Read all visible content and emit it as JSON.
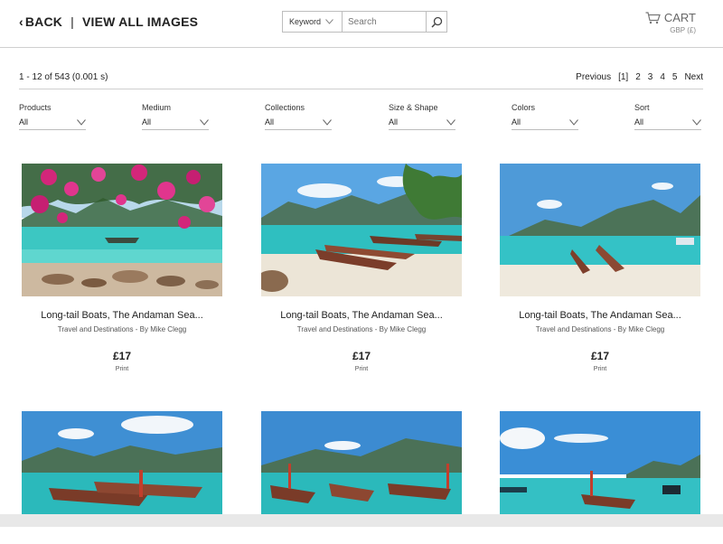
{
  "header": {
    "back_label": "BACK",
    "separator": "|",
    "view_all_label": "VIEW ALL IMAGES",
    "search_mode": "Keyword",
    "search_placeholder": "Search",
    "cart_label": "CART",
    "currency": "GBP (£)"
  },
  "results": {
    "summary": "1 - 12 of 543 (0.001 s)",
    "pager": {
      "previous": "Previous",
      "current": "[1]",
      "pages": [
        "2",
        "3",
        "4",
        "5"
      ],
      "next": "Next"
    }
  },
  "filters": [
    {
      "label": "Products",
      "value": "All"
    },
    {
      "label": "Medium",
      "value": "All"
    },
    {
      "label": "Collections",
      "value": "All"
    },
    {
      "label": "Size & Shape",
      "value": "All"
    },
    {
      "label": "Colors",
      "value": "All"
    },
    {
      "label": "Sort",
      "value": "All"
    }
  ],
  "products": [
    {
      "title": "Long-tail Boats, The Andaman Sea...",
      "subtitle": "Travel and Destinations - By Mike Clegg",
      "price": "£17",
      "type": "Print",
      "image": "flowers-over-bay"
    },
    {
      "title": "Long-tail Boats, The Andaman Sea...",
      "subtitle": "Travel and Destinations - By Mike Clegg",
      "price": "£17",
      "type": "Print",
      "image": "boats-on-beach-tree"
    },
    {
      "title": "Long-tail Boats, The Andaman Sea...",
      "subtitle": "Travel and Destinations - By Mike Clegg",
      "price": "£17",
      "type": "Print",
      "image": "two-boats-beach"
    },
    {
      "image": "boats-row-clouds"
    },
    {
      "image": "boats-row-mountains"
    },
    {
      "image": "boats-wide-sky"
    }
  ],
  "colors": {
    "accent": "#222222",
    "rule": "#cfcfcf",
    "sea": "#3fc1c1",
    "sky": "#5a9fd9"
  }
}
